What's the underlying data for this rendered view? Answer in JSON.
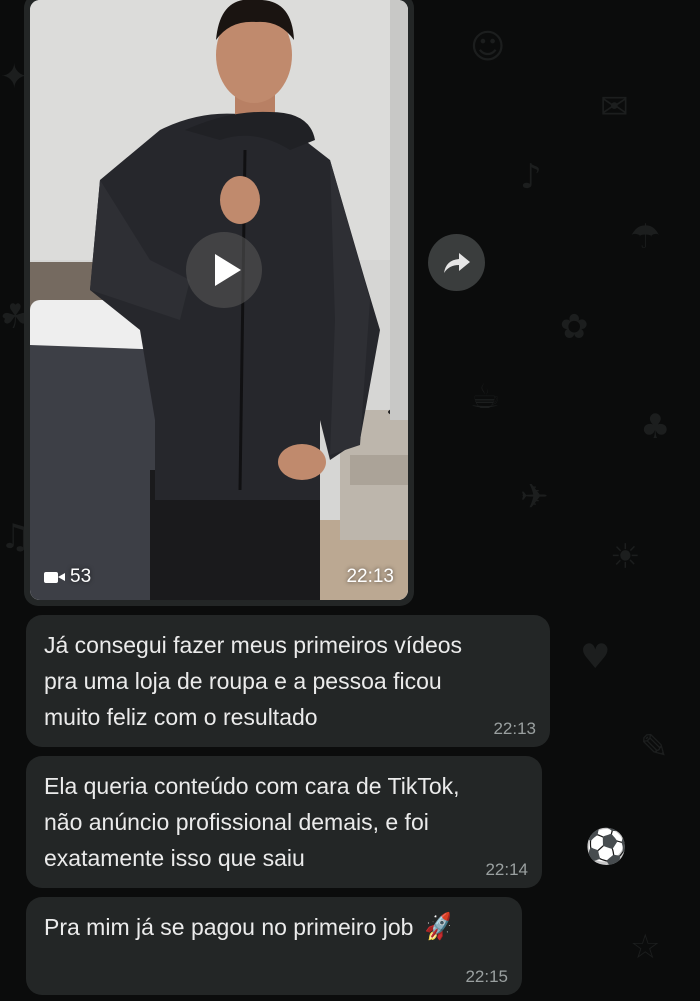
{
  "video": {
    "duration": "53",
    "time": "22:13"
  },
  "messages": [
    {
      "text": "Já consegui fazer meus primeiros vídeos\npra uma loja de roupa e a pessoa ficou\nmuito feliz com o resultado",
      "time": "22:13"
    },
    {
      "text": "Ela queria conteúdo com cara de TikTok,\nnão anúncio profissional demais, e foi\nexatamente isso que saiu",
      "time": "22:14"
    },
    {
      "text": "Pra mim já se pagou no primeiro job",
      "time": "22:15",
      "emoji": "🚀"
    }
  ],
  "colors": {
    "background": "#0b0c0c",
    "bubble": "#232626",
    "text": "#ebebeb",
    "timestamp": "#9aa0a0"
  },
  "icons": [
    "play-icon",
    "video-camera-icon",
    "forward-icon",
    "rocket-emoji"
  ]
}
